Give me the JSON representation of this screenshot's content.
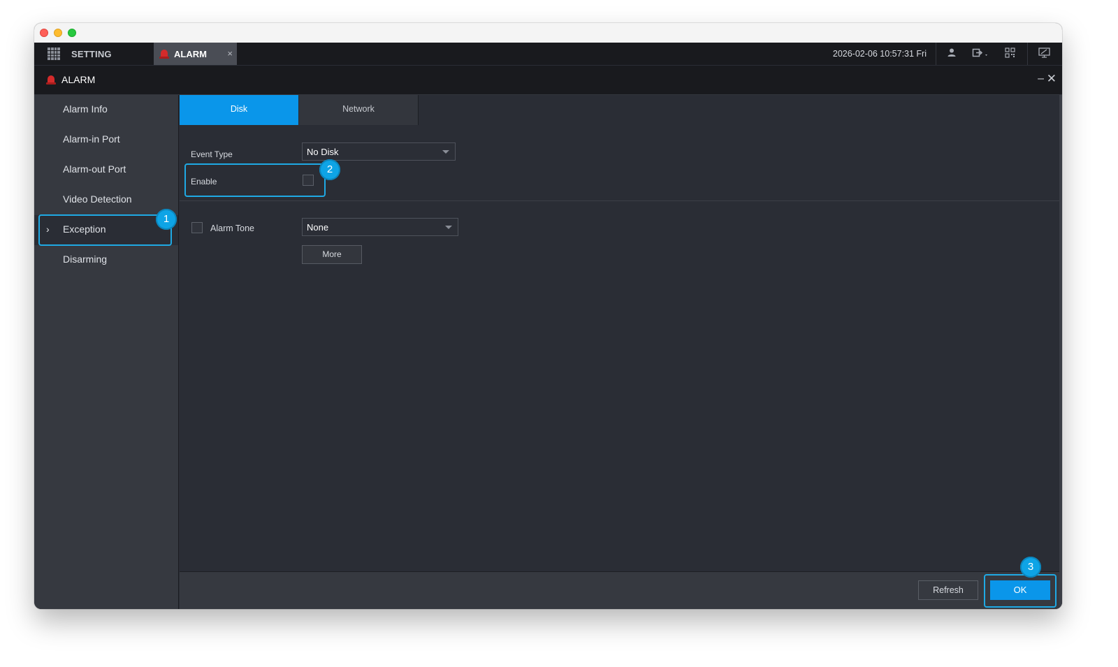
{
  "topbar": {
    "setting_tab_label": "SETTING",
    "alarm_tab_label": "ALARM",
    "alarm_tab_close": "×",
    "datetime": "2026-02-06 10:57:31 Fri"
  },
  "header": {
    "title": "ALARM",
    "minimize": "–",
    "close": "✕"
  },
  "sidebar": {
    "items": [
      {
        "label": "Alarm Info"
      },
      {
        "label": "Alarm-in Port"
      },
      {
        "label": "Alarm-out Port"
      },
      {
        "label": "Video Detection"
      },
      {
        "label": "Exception",
        "active": true
      },
      {
        "label": "Disarming"
      }
    ],
    "active_marker": "›"
  },
  "tabs": [
    {
      "label": "Disk",
      "active": true
    },
    {
      "label": "Network",
      "active": false
    }
  ],
  "form": {
    "event_type_label": "Event Type",
    "event_type_value": "No Disk",
    "enable_label": "Enable",
    "enable_checked": false,
    "alarm_tone_label": "Alarm Tone",
    "alarm_tone_checked": false,
    "alarm_tone_value": "None",
    "more_label": "More"
  },
  "footer": {
    "refresh_label": "Refresh",
    "ok_label": "OK"
  },
  "callouts": [
    "1",
    "2",
    "3"
  ],
  "colors": {
    "accent": "#0a96ea",
    "callout": "#1fa9e4",
    "alarm_red": "#d42b2b",
    "background": "#2a2d35",
    "sidebar": "#363940",
    "topbar": "#191a1e"
  },
  "icons": [
    "grid-menu-icon",
    "siren-icon",
    "user-icon",
    "logout-icon",
    "qr-code-icon",
    "monitor-icon",
    "chevron-right-icon",
    "dropdown-caret-icon"
  ]
}
